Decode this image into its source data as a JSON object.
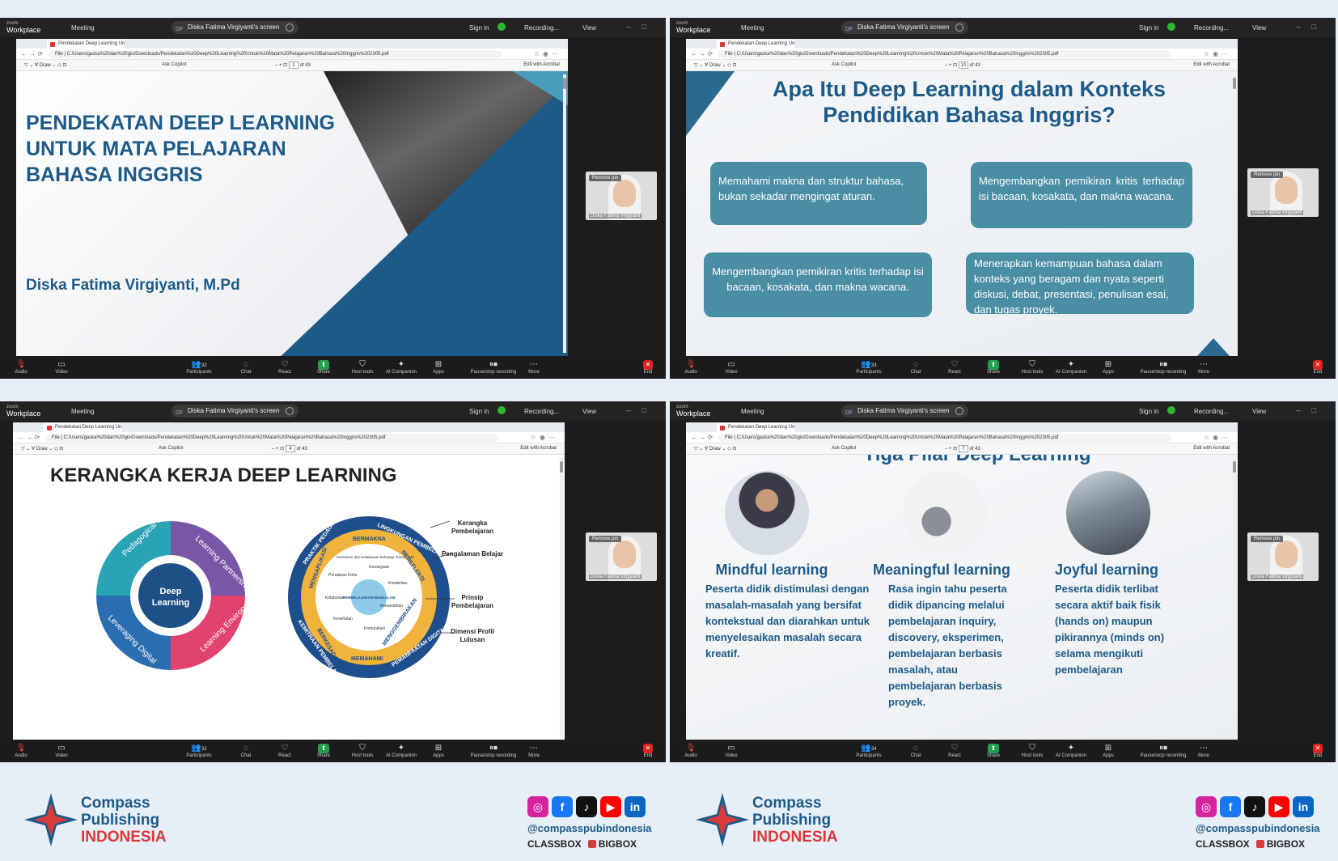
{
  "zoom": {
    "logo_top": "zoom",
    "logo_bottom": "Workplace",
    "meeting": "Meeting",
    "df": "DF",
    "screen_share": "Diska Fatima Virgiyanti's screen",
    "sign_in": "Sign in",
    "recording": "Recording...",
    "view": "View",
    "remove_pin": "Remove pin",
    "participant_name": "Diska Fatima Virgiyanti",
    "bottom": {
      "audio": "Audio",
      "video": "Video",
      "participants": "Participants",
      "chat": "Chat",
      "react": "React",
      "share": "Share",
      "host_tools": "Host tools",
      "ai_companion": "AI Companion",
      "apps": "Apps",
      "pause_recording": "Pause/stop recording",
      "more": "More",
      "end": "End"
    },
    "participant_counts": [
      "32",
      "33",
      "32",
      "34"
    ]
  },
  "browser": {
    "tab": "Pendekatan Deep Learning Untu",
    "url_prefix": "File",
    "url": "C:/Users/gaska%20dan%20gio/Downloads/Pendekatan%20Deep%20Learning%20Untuk%20Mata%20Pelajaran%20Bahasa%20Inggris%202305.pdf",
    "draw": "Draw",
    "ask_copilot": "Ask Copilot",
    "edit_acrobat": "Edit with Acrobat",
    "pages": [
      "1",
      "10",
      "4",
      "7"
    ],
    "of_total": "of 43"
  },
  "slide1": {
    "title_lines": [
      "PENDEKATAN DEEP LEARNING",
      "UNTUK MATA PELAJARAN",
      "BAHASA INGGRIS"
    ],
    "author": "Diska Fatima Virgiyanti, M.Pd"
  },
  "slide2": {
    "title_line1": "Apa Itu Deep Learning dalam Konteks",
    "title_line2": "Pendidikan Bahasa Inggris?",
    "cards": [
      "Memahami makna dan struktur bahasa, bukan sekadar mengingat aturan.",
      "Mengembangkan pemikiran kritis terhadap isi bacaan, kosakata, dan makna wacana.",
      "Mengembangkan pemikiran kritis terhadap isi bacaan, kosakata, dan makna wacana.",
      "Menerapkan kemampuan bahasa dalam konteks yang beragam dan nyata seperti diskusi, debat, presentasi, penulisan esai, dan tugas proyek."
    ]
  },
  "slide3": {
    "title": "KERANGKA KERJA DEEP LEARNING",
    "wheel_center": [
      "Deep",
      "Learning"
    ],
    "wheel_segments": [
      "Pedagogical Practices",
      "Learning Partnerships",
      "Learning Environments",
      "Leveraging Digital"
    ],
    "ring_outer": [
      "PRAKTIK PEDAGOGIS",
      "LINGKUNGAN PEMBELAJARAN",
      "KEMITRAAN PEMBELAJARAN",
      "PEMANFAATAN DIGITAL"
    ],
    "ring_middle": [
      "MENGAPLIKASI",
      "BERMAKNA",
      "MEREFLEKSI",
      "MENGGEMBIRAKAN",
      "MEMAHAMI",
      "BERKESADARAN"
    ],
    "ring_inner": [
      "Keimanan dan Ketakwaan terhadap Tuhan YME",
      "Kewargaan",
      "Penalaran Kritis",
      "Kreativitas",
      "Kolaborasi",
      "Kemandirian",
      "Kesehatan",
      "Komunikasi"
    ],
    "ring_center": "PEMBELAJARAN MENDALAM",
    "side_labels": [
      "Kerangka Pembelajaran",
      "Pengalaman Belajar",
      "Prinsip Pembelajaran",
      "Dimensi Profil Lulusan"
    ]
  },
  "slide4": {
    "cut_title": "Tiga Pilar Deep Learning",
    "pillars": [
      {
        "title": "Mindful learning",
        "body": "Peserta didik distimulasi dengan masalah-masalah yang bersifat kontekstual dan diarahkan untuk menyelesaikan masalah secara kreatif."
      },
      {
        "title": "Meaningful learning",
        "body": "Rasa ingin tahu peserta didik dipancing melalui pembelajaran inquiry, discovery, eksperimen, pembelajaran berbasis masalah, atau pembelajaran berbasis proyek."
      },
      {
        "title": "Joyful learning",
        "body": "Peserta didik terlibat secara aktif baik fisik (hands on) maupun pikirannya (minds on) selama mengikuti pembelajaran"
      }
    ]
  },
  "footer": {
    "line1": "Compass",
    "line2": "Publishing",
    "line3": "INDONESIA",
    "handle": "@compasspubindonesia",
    "brand1": "CLASSBOX",
    "brand2": "BIGBOX",
    "colors": {
      "instagram": "#d6249f",
      "facebook": "#1877f2",
      "tiktok": "#111111",
      "youtube": "#ff0000",
      "linkedin": "#0a66c2"
    }
  }
}
